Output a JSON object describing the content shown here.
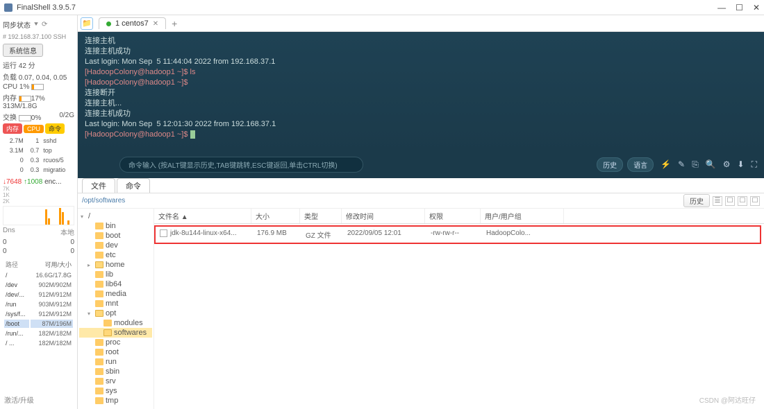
{
  "window": {
    "title": "FinalShell 3.9.5.7"
  },
  "left": {
    "sync": "同步状态",
    "ip": "# 192.168.37.100 SSH",
    "sysinfo_btn": "系统信息",
    "run_line": "运行 42 分",
    "load_line": "负载 0.07, 0.04, 0.05",
    "cpu_line": "CPU  1%",
    "mem_label": "内存",
    "mem_pct": "17%",
    "mem_val": "313M/1.8G",
    "swap_label": "交换",
    "swap_pct": "0%",
    "swap_val": "0/2G",
    "pills": [
      "内存",
      "CPU",
      "命令"
    ],
    "proc": [
      [
        "2.7M",
        "1",
        "sshd"
      ],
      [
        "3.1M",
        "0.7",
        "top"
      ],
      [
        "0",
        "0.3",
        "rcuos/5"
      ],
      [
        "0",
        "0.3",
        "migratio"
      ]
    ],
    "stats": {
      "red": "↓7648",
      "green": "↑1008",
      "suffix": "enc..."
    },
    "yl": [
      "7K",
      "1K",
      "2K"
    ],
    "dns_h1": "Dns",
    "dns_h2": "本地",
    "dns": [
      [
        "0",
        "0"
      ],
      [
        "0",
        "0"
      ]
    ],
    "disk_h1": "路径",
    "disk_h2": "可用/大小",
    "disks": [
      [
        "/",
        "16.6G/17.8G"
      ],
      [
        "/dev",
        "902M/902M"
      ],
      [
        "/dev/...",
        "912M/912M"
      ],
      [
        "/run",
        "903M/912M"
      ],
      [
        "/sys/f...",
        "912M/912M"
      ],
      [
        "/boot",
        "87M/196M"
      ],
      [
        "/run/...",
        "182M/182M"
      ],
      [
        "/ ...",
        "182M/182M"
      ]
    ],
    "footer": "激活/升级"
  },
  "tabs": {
    "main": "1 centos7"
  },
  "term": {
    "lines": [
      "连接主机",
      "连接主机成功",
      "Last login: Mon Sep  5 11:44:04 2022 from 192.168.37.1",
      "[HadoopColony@hadoop1 ~]$ ls",
      "[HadoopColony@hadoop1 ~]$",
      "连接断开",
      "连接主机...",
      "连接主机成功",
      "Last login: Mon Sep  5 12:01:30 2022 from 192.168.37.1",
      "[HadoopColony@hadoop1 ~]$ "
    ]
  },
  "cmdbar": {
    "hint": "命令输入 (按ALT键显示历史,TAB键跳转,ESC键返回,单击CTRL切换)",
    "b1": "历史",
    "b2": "语言"
  },
  "lowtabs": {
    "t1": "文件",
    "t2": "命令"
  },
  "path": {
    "value": "/opt/softwares",
    "b_hist": "历史",
    "b_view": "□"
  },
  "filehdr": {
    "name": "文件名 ▲",
    "size": "大小",
    "type": "类型",
    "mtime": "修改时间",
    "perm": "权限",
    "owner": "用户/用户组"
  },
  "file": {
    "name": "jdk-8u144-linux-x64...",
    "size": "176.9 MB",
    "type": "GZ 文件",
    "mtime": "2022/09/05 12:01",
    "perm": "-rw-rw-r--",
    "owner": "HadoopColo..."
  },
  "tree": {
    "root": "/",
    "nodes1": [
      "bin",
      "boot",
      "dev",
      "etc"
    ],
    "home": "home",
    "nodes2": [
      "lib",
      "lib64",
      "media",
      "mnt"
    ],
    "opt": "opt",
    "opt_children": [
      "modules",
      "softwares"
    ],
    "nodes3": [
      "proc",
      "root",
      "run",
      "sbin",
      "srv",
      "sys",
      "tmp"
    ]
  },
  "watermark": "CSDN @阿达旺仔"
}
